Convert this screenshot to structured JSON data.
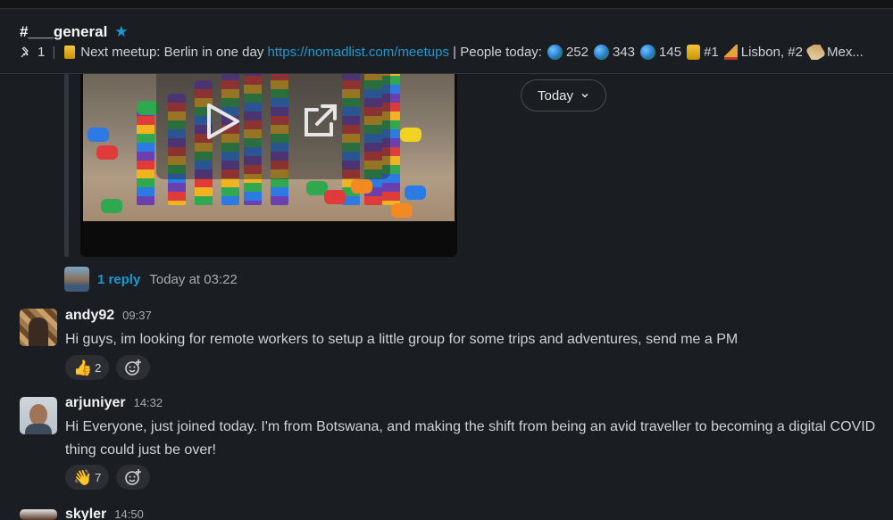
{
  "header": {
    "channel_name": "#___general",
    "topic": {
      "pinned_count": "1",
      "meetup_text": "Next meetup: Berlin in one day",
      "meetup_link": "https://nomadlist.com/meetups",
      "people_prefix": "| People today:",
      "count1": "252",
      "count2": "343",
      "count3": "145",
      "rank1": "#1",
      "city1": "Lisbon, #2",
      "city2": "Mex..."
    }
  },
  "date_divider": {
    "label": "Today"
  },
  "thread": {
    "reply_label": "1 reply",
    "reply_time": "Today at 03:22"
  },
  "messages": [
    {
      "user": "andy92",
      "time": "09:37",
      "text": "Hi guys, im looking for remote workers to setup a little group for some trips and adventures, send me a PM",
      "reaction": {
        "emoji": "thumbs-up",
        "count": "2"
      }
    },
    {
      "user": "arjuniyer",
      "time": "14:32",
      "text": "Hi Everyone, just joined today. I'm from Botswana, and making the shift from being an avid traveller to becoming a digital COVID thing could just be over!",
      "reaction": {
        "emoji": "waving-hand",
        "count": "7"
      }
    },
    {
      "user": "skyler",
      "time": "14:50"
    }
  ],
  "colors": {
    "background": "#1a1d21",
    "link": "#1d9bd1",
    "star": "#1d9bd1",
    "reaction_bg": "#2c2e33"
  }
}
